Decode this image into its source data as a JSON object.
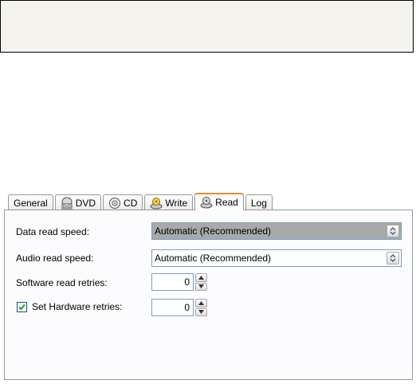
{
  "tabs": [
    {
      "label": "General",
      "icon": ""
    },
    {
      "label": "DVD",
      "icon": "dvd-drive-icon"
    },
    {
      "label": "CD",
      "icon": "cd-disc-icon"
    },
    {
      "label": "Write",
      "icon": "write-disc-icon"
    },
    {
      "label": "Read",
      "icon": "read-disc-icon",
      "active": true
    },
    {
      "label": "Log",
      "icon": ""
    }
  ],
  "read_panel": {
    "data_read_speed_label": "Data read speed:",
    "data_read_speed_value": "Automatic (Recommended)",
    "audio_read_speed_label": "Audio read speed:",
    "audio_read_speed_value": "Automatic (Recommended)",
    "software_read_retries_label": "Software read retries:",
    "software_read_retries_value": "0",
    "set_hardware_retries_label": "Set Hardware retries:",
    "set_hardware_retries_checked": true,
    "hardware_retries_value": "0"
  },
  "colors": {
    "active_tab_accent": "#e68b2c",
    "field_border": "#7f9db9",
    "selected_field_bg": "#a9a9a9"
  }
}
